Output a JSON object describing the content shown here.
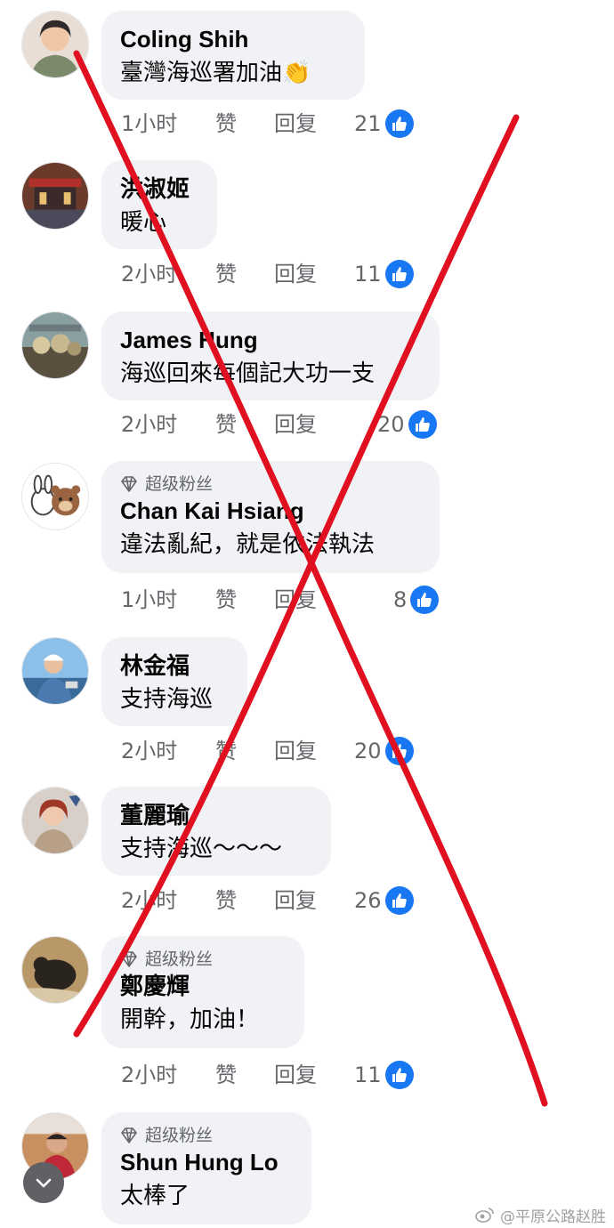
{
  "comments": [
    {
      "name": "Coling Shih",
      "text": "臺灣海巡署加油👏",
      "time": "1小时",
      "like": "赞",
      "reply": "回复",
      "likes": "21"
    },
    {
      "name": "洪淑姬",
      "text": "暖心",
      "time": "2小时",
      "like": "赞",
      "reply": "回复",
      "likes": "11"
    },
    {
      "name": "James Hung",
      "text": "海巡回來每個記大功一支",
      "time": "2小时",
      "like": "赞",
      "reply": "回复",
      "likes": "20"
    },
    {
      "badge": "超级粉丝",
      "name": "Chan Kai Hsiang",
      "text": "違法亂紀，就是依法執法",
      "time": "1小时",
      "like": "赞",
      "reply": "回复",
      "likes": "8"
    },
    {
      "name": "林金福",
      "text": "支持海巡",
      "time": "2小时",
      "like": "赞",
      "reply": "回复",
      "likes": "20"
    },
    {
      "name": "董麗瑜",
      "text": "支持海巡～～～",
      "time": "2小时",
      "like": "赞",
      "reply": "回复",
      "likes": "26"
    },
    {
      "badge": "超级粉丝",
      "name": "鄭慶輝",
      "text": "開幹，加油！",
      "time": "2小时",
      "like": "赞",
      "reply": "回复",
      "likes": "11"
    },
    {
      "badge": "超级粉丝",
      "name": "Shun Hung Lo",
      "text": "太棒了"
    }
  ],
  "watermark": "@平原公路赵胜",
  "colors": {
    "like_blue": "#1877f2",
    "bubble": "#f0f2f5",
    "cross_red": "#e01020",
    "meta_gray": "#65676b"
  },
  "icons": {
    "like": "thumbs-up-icon",
    "badge": "diamond-icon",
    "back": "chevron-down-icon",
    "watermark": "weibo-icon"
  }
}
